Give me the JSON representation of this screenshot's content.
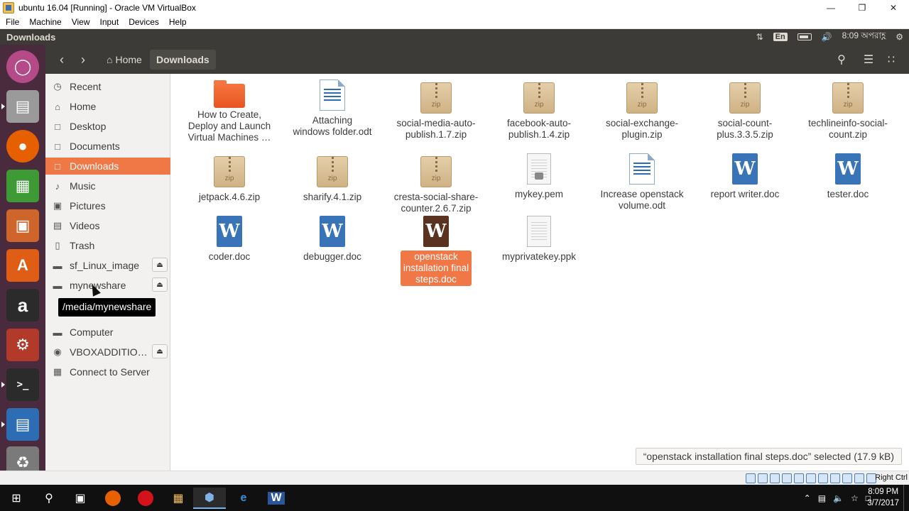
{
  "window": {
    "title": "ubuntu 16.04 [Running] - Oracle VM VirtualBox",
    "menu": [
      "File",
      "Machine",
      "View",
      "Input",
      "Devices",
      "Help"
    ]
  },
  "panel": {
    "title": "Downloads",
    "lang": "En",
    "time": "8:09 অপরাহ্ণ"
  },
  "toolbar": {
    "home_label": "Home",
    "current_label": "Downloads"
  },
  "sidebar": {
    "items": [
      {
        "label": "Recent",
        "icon": "clock-icon"
      },
      {
        "label": "Home",
        "icon": "home-icon"
      },
      {
        "label": "Desktop",
        "icon": "folder-icon"
      },
      {
        "label": "Documents",
        "icon": "folder-icon"
      },
      {
        "label": "Downloads",
        "icon": "folder-icon"
      },
      {
        "label": "Music",
        "icon": "music-icon"
      },
      {
        "label": "Pictures",
        "icon": "camera-icon"
      },
      {
        "label": "Videos",
        "icon": "film-icon"
      },
      {
        "label": "Trash",
        "icon": "trash-icon"
      },
      {
        "label": "sf_Linux_image",
        "icon": "drive-icon"
      },
      {
        "label": "mynewshare",
        "icon": "drive-icon"
      },
      {
        "label": "Computer",
        "icon": "drive-icon"
      },
      {
        "label": "VBOXADDITIO…",
        "icon": "disc-icon"
      },
      {
        "label": "Connect to Server",
        "icon": "server-icon"
      }
    ],
    "tooltip": "/media/mynewshare"
  },
  "files": [
    {
      "lines": [
        "How to Create,",
        "Deploy and Launch",
        "Virtual Machines …"
      ],
      "kind": "folder"
    },
    {
      "lines": [
        "Attaching",
        "windows folder.odt"
      ],
      "kind": "odt"
    },
    {
      "lines": [
        "social-media-auto-",
        "publish.1.7.zip"
      ],
      "kind": "zip"
    },
    {
      "lines": [
        "facebook-auto-",
        "publish.1.4.zip"
      ],
      "kind": "zip"
    },
    {
      "lines": [
        "social-exchange-",
        "plugin.zip"
      ],
      "kind": "zip"
    },
    {
      "lines": [
        "social-count-",
        "plus.3.3.5.zip"
      ],
      "kind": "zip"
    },
    {
      "lines": [
        "techlineinfo-social-",
        "count.zip"
      ],
      "kind": "zip"
    },
    {
      "lines": [
        "jetpack.4.6.zip"
      ],
      "kind": "zip"
    },
    {
      "lines": [
        "sharify.4.1.zip"
      ],
      "kind": "zip"
    },
    {
      "lines": [
        "cresta-social-share-",
        "counter.2.6.7.zip"
      ],
      "kind": "zip"
    },
    {
      "lines": [
        "mykey.pem"
      ],
      "kind": "key"
    },
    {
      "lines": [
        "Increase openstack",
        "volume.odt"
      ],
      "kind": "odt"
    },
    {
      "lines": [
        "report writer.doc"
      ],
      "kind": "doc"
    },
    {
      "lines": [
        "tester.doc"
      ],
      "kind": "doc"
    },
    {
      "lines": [
        "coder.doc"
      ],
      "kind": "doc"
    },
    {
      "lines": [
        "debugger.doc"
      ],
      "kind": "doc"
    },
    {
      "lines": [
        "openstack",
        "installation final",
        "steps.doc"
      ],
      "kind": "doc-dark"
    },
    {
      "lines": [
        "myprivatekey.ppk"
      ],
      "kind": "txt"
    }
  ],
  "zip_tag": "zip",
  "doc_tag": "W",
  "status": "“openstack installation final steps.doc” selected  (17.9 kB)",
  "vb_status": {
    "host_key": "Right Ctrl"
  },
  "taskbar": {
    "time": "8:09 PM",
    "date": "3/7/2017"
  },
  "colors": {
    "accent": "#f07746",
    "panel": "#3c3b37",
    "launcher": "#4a2b3d"
  }
}
